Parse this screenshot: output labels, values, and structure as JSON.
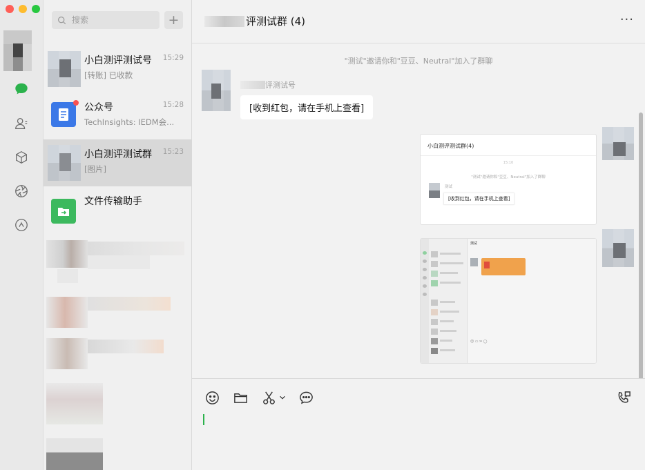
{
  "window": {
    "traffic_lights": [
      {
        "name": "close",
        "color": "#ff5f57"
      },
      {
        "name": "minimize",
        "color": "#febc2e"
      },
      {
        "name": "zoom",
        "color": "#28c840"
      }
    ]
  },
  "rail": {
    "icons": [
      "chat-icon",
      "contacts-icon",
      "favorites-box-icon",
      "moments-aperture-icon",
      "channels-icon"
    ],
    "active_color": "#2bb24c"
  },
  "search": {
    "placeholder": "搜索",
    "add_label": "+"
  },
  "conversations": [
    {
      "name": "小白测评测试号",
      "time": "15:29",
      "preview": "[转账] 已收款",
      "avatar": "blurred"
    },
    {
      "name": "公众号",
      "time": "15:28",
      "preview": "TechInsights: IEDM会...",
      "avatar": "official-accounts-icon",
      "badge_color": "#fa5151"
    },
    {
      "name": "小白测评测试群",
      "time": "15:23",
      "preview": "[图片]",
      "avatar": "blurred",
      "active": true
    },
    {
      "name": "文件传输助手",
      "time": "",
      "preview": "",
      "avatar": "file-transfer-icon"
    }
  ],
  "chat": {
    "title": "评测试群 (4)",
    "more_label": "···",
    "system_message": "\"测试\"邀请你和\"豆豆、Neutral\"加入了群聊",
    "sender_name": "评测试号",
    "message_text": "[收到红包，请在手机上查看]",
    "image1": {
      "title": "小白测评测试群(4)",
      "time": "15:10",
      "system": "\"测试\"邀请你和\"豆豆、Neutral\"加入了群聊",
      "sender": "测试",
      "bubble": "[收到红包，请在手机上查看]"
    },
    "image2": {
      "header": "测试"
    }
  },
  "toolbar": {
    "tools": [
      "emoji-icon",
      "folder-icon",
      "scissors-screenshot-icon",
      "chevron-down-icon",
      "chat-history-icon",
      "voice-call-icon"
    ]
  }
}
